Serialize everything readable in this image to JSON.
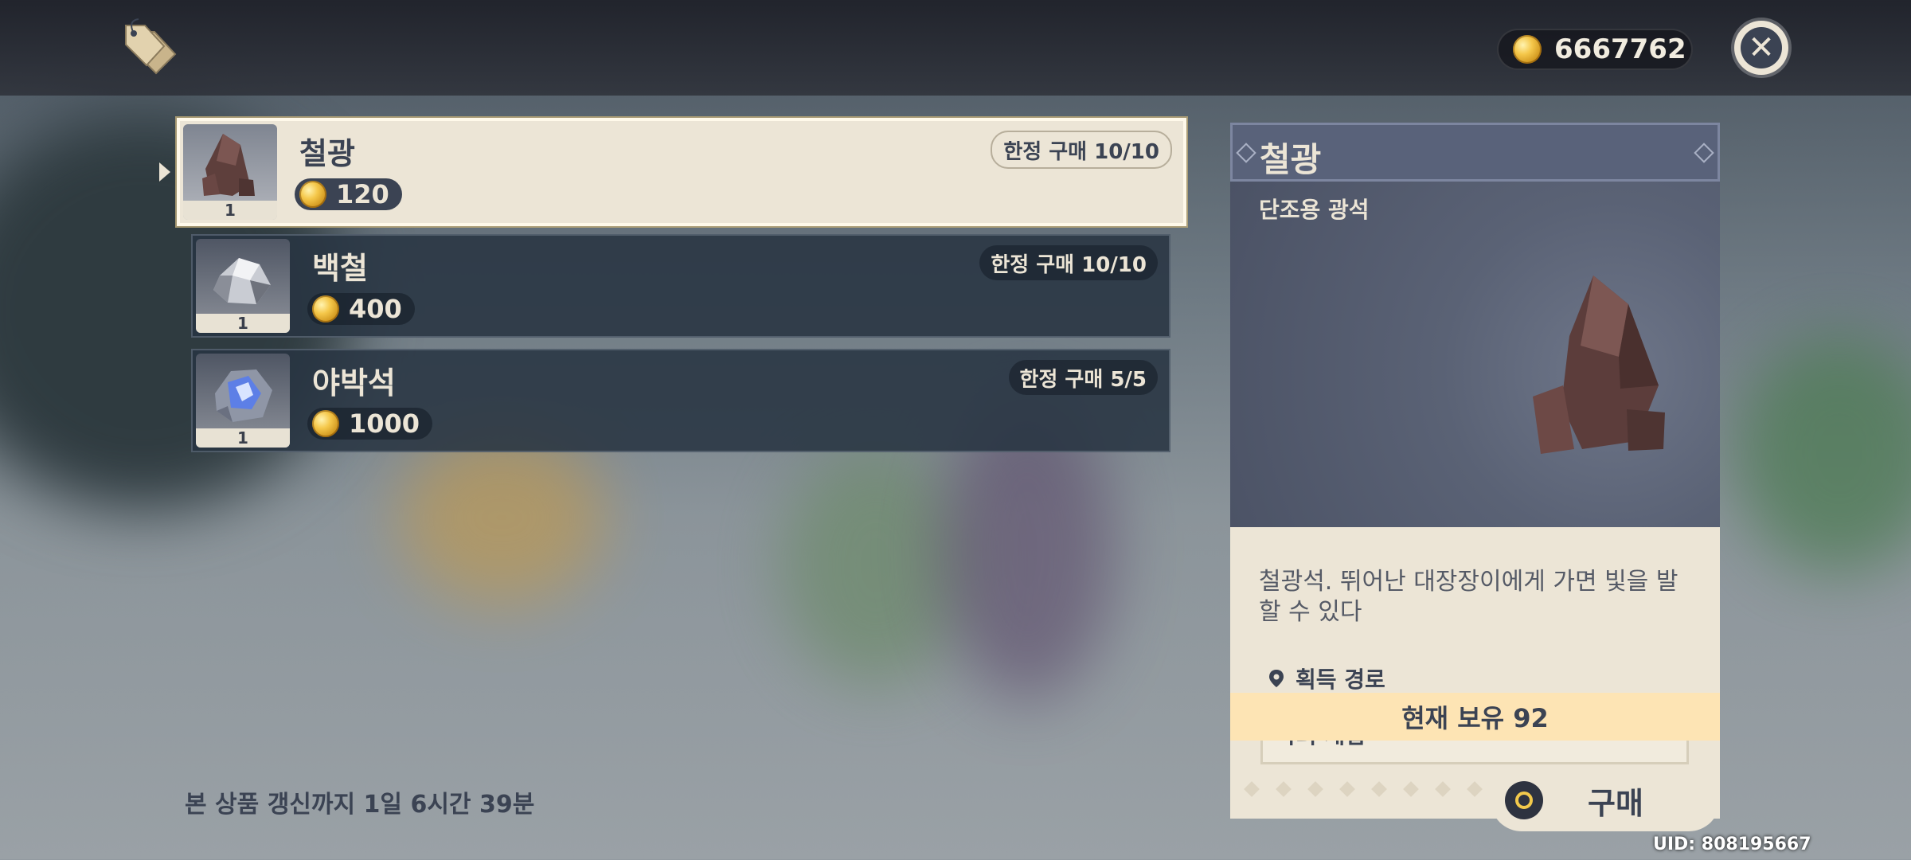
{
  "currency": {
    "amount": "6667762"
  },
  "items": [
    {
      "name": "철광",
      "price": "120",
      "qty": "1",
      "limit": "한정 구매 10/10"
    },
    {
      "name": "백철",
      "price": "400",
      "qty": "1",
      "limit": "한정 구매 10/10"
    },
    {
      "name": "야박석",
      "price": "1000",
      "qty": "1",
      "limit": "한정 구매 5/5"
    }
  ],
  "detail": {
    "title": "철광",
    "subtitle": "단조용 광석",
    "description": "철광석. 뛰어난 대장장이에게 가면 빛을 발할 수 있다",
    "source_label": "획득 경로",
    "source_value": "야외 채집",
    "owned": "현재 보유 92"
  },
  "footer": {
    "refresh_text": "본 상품 갱신까지 1일 6시간 39분",
    "buy_label": "구매",
    "uid": "UID: 808195667"
  },
  "icons": {
    "shop": "price-tag-icon",
    "coin": "mora-coin-icon",
    "close": "close-icon",
    "location": "location-pin-icon",
    "buy": "confirm-button-icon"
  },
  "colors": {
    "panel_cream": "#ece5d6",
    "panel_navy": "#3b4353",
    "owned_highlight": "#fde4b4"
  }
}
